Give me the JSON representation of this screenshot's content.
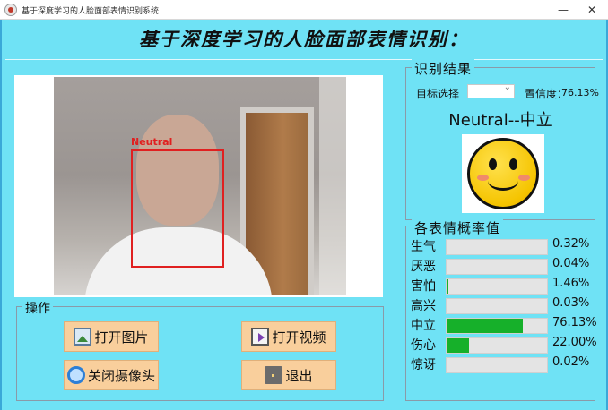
{
  "window": {
    "title": "基于深度学习的人脸面部表情识别系统",
    "minimize_glyph": "—",
    "close_glyph": "✕"
  },
  "header": {
    "title": "基于深度学习的人脸面部表情识别："
  },
  "video": {
    "face_label": "Neutral"
  },
  "operations": {
    "legend": "操作",
    "open_image": "打开图片",
    "open_video": "打开视频",
    "close_camera": "关闭摄像头",
    "exit": "退出",
    "icons": [
      "image-icon",
      "video-icon",
      "camera-icon",
      "exit-door-icon"
    ]
  },
  "result": {
    "legend": "识别结果",
    "target_label": "目标选择",
    "target_value": "",
    "confidence_label": "置信度：",
    "confidence_value": "76.13%",
    "text": "Neutral--中立",
    "emoji": "smiley-face-icon"
  },
  "probabilities": {
    "legend": "各表情概率值",
    "bar_color": "#16b02a",
    "items": [
      {
        "label": "生气",
        "value": "0.32%",
        "fraction": 0.0032
      },
      {
        "label": "厌恶",
        "value": "0.04%",
        "fraction": 0.0004
      },
      {
        "label": "害怕",
        "value": "1.46%",
        "fraction": 0.0146
      },
      {
        "label": "高兴",
        "value": "0.03%",
        "fraction": 0.0003
      },
      {
        "label": "中立",
        "value": "76.13%",
        "fraction": 0.7613
      },
      {
        "label": "伤心",
        "value": "22.00%",
        "fraction": 0.22
      },
      {
        "label": "惊讶",
        "value": "0.02%",
        "fraction": 0.0002
      }
    ]
  },
  "colors": {
    "background": "#6fe2f5",
    "button": "#f9cf9c",
    "face_box": "#e02020"
  }
}
